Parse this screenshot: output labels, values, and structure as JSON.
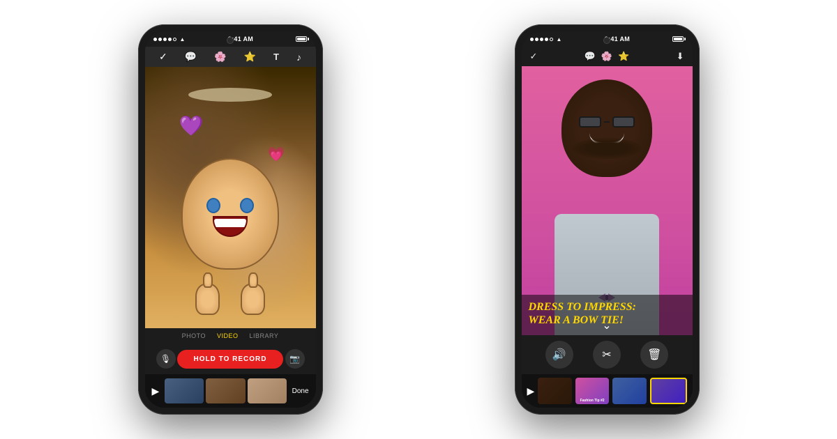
{
  "background_color": "#ffffff",
  "phone1": {
    "status_bar": {
      "time": "9:41 AM",
      "signal_dots": [
        "filled",
        "filled",
        "filled",
        "filled",
        "empty"
      ]
    },
    "toolbar": {
      "back_icon": "✓",
      "icons": [
        "💬",
        "🌸",
        "⭐",
        "T",
        "♪"
      ]
    },
    "capture_tabs": [
      {
        "label": "PHOTO",
        "active": false
      },
      {
        "label": "VIDEO",
        "active": true
      },
      {
        "label": "LIBRARY",
        "active": false
      }
    ],
    "record_button": {
      "label": "HOLD TO RECORD"
    },
    "timeline": {
      "play_icon": "▶",
      "done_label": "Done"
    },
    "emojis": {
      "purple_heart": "💜",
      "pink_heart": "💗"
    }
  },
  "phone2": {
    "status_bar": {
      "time": "9:41 AM"
    },
    "toolbar": {
      "back_icon": "✓",
      "icons": [
        "💬",
        "🌸",
        "⭐"
      ],
      "download_icon": "⬇"
    },
    "video_text_overlay": "DRESS TO IMPRESS:\nWEAR A BOW TIE!",
    "video_text_line1": "DRESS TO IMPRESS:",
    "video_text_line2": "WEAR A BOW TIE!",
    "edit_controls": {
      "sound_icon": "🔊",
      "scissors_icon": "✂",
      "trash_icon": "🗑"
    },
    "clips": [
      {
        "label": ""
      },
      {
        "label": "Fashion\nTip #2"
      },
      {
        "label": ""
      },
      {
        "label": ""
      }
    ]
  }
}
